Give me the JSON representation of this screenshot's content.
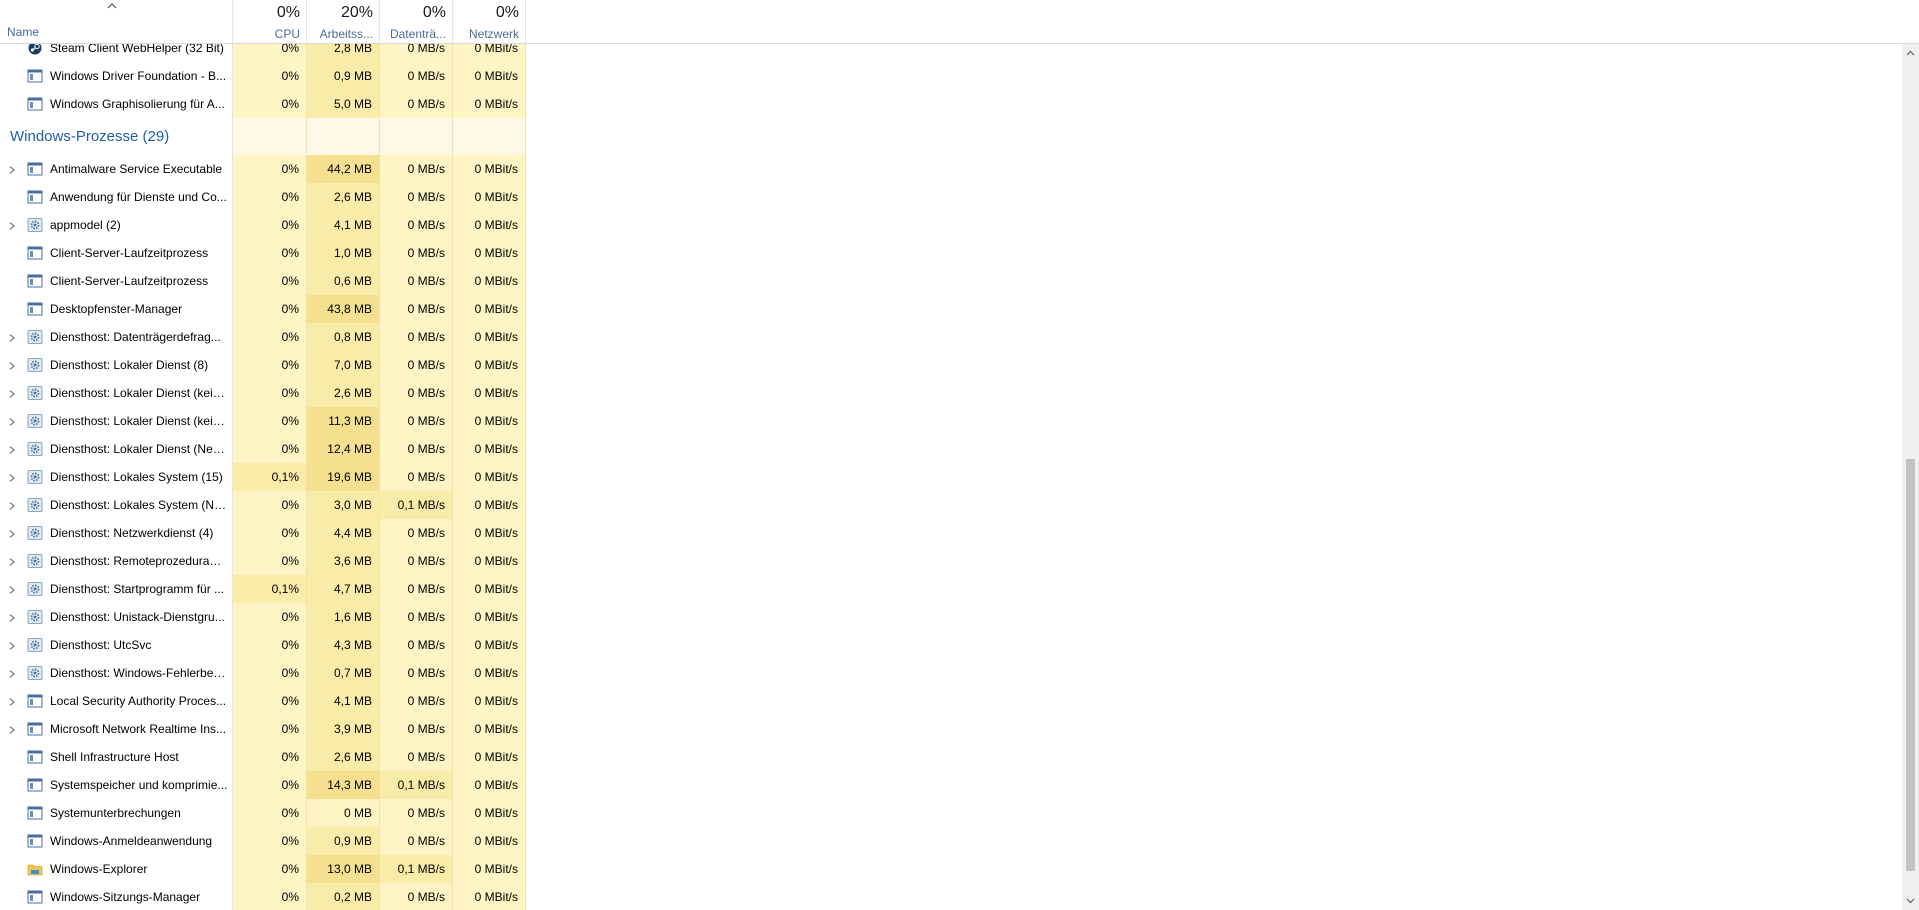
{
  "columns": {
    "name": {
      "label": "Name"
    },
    "cpu": {
      "percent": "0%",
      "label": "CPU"
    },
    "memory": {
      "percent": "20%",
      "label": "Arbeitss..."
    },
    "disk": {
      "percent": "0%",
      "label": "Datenträ..."
    },
    "network": {
      "percent": "0%",
      "label": "Netzwerk"
    }
  },
  "colors": {
    "heat_low": "#fff4c4",
    "heat_mid": "#f9eca9",
    "heat_high": "#f4e08f",
    "group_title": "#1e5fa8"
  },
  "top_rows": [
    {
      "name": "Steam Client WebHelper (32 Bit)",
      "cpu": "0%",
      "mem": "2,8 MB",
      "disk": "0 MB/s",
      "net": "0 MBit/s",
      "icon": "steam-icon",
      "expand": false
    },
    {
      "name": "Windows Driver Foundation - B...",
      "cpu": "0%",
      "mem": "0,9 MB",
      "disk": "0 MB/s",
      "net": "0 MBit/s",
      "icon": "window-icon",
      "expand": false
    },
    {
      "name": "Windows Graphisolierung für A...",
      "cpu": "0%",
      "mem": "5,0 MB",
      "disk": "0 MB/s",
      "net": "0 MBit/s",
      "icon": "window-icon",
      "expand": false
    }
  ],
  "group": {
    "title": "Windows-Prozesse (29)"
  },
  "rows": [
    {
      "name": "Antimalware Service Executable",
      "cpu": "0%",
      "mem": "44,2 MB",
      "disk": "0 MB/s",
      "net": "0 MBit/s",
      "icon": "window-icon",
      "expand": true
    },
    {
      "name": "Anwendung für Dienste und Co...",
      "cpu": "0%",
      "mem": "2,6 MB",
      "disk": "0 MB/s",
      "net": "0 MBit/s",
      "icon": "window-icon",
      "expand": false
    },
    {
      "name": "appmodel (2)",
      "cpu": "0%",
      "mem": "4,1 MB",
      "disk": "0 MB/s",
      "net": "0 MBit/s",
      "icon": "gear-icon",
      "expand": true
    },
    {
      "name": "Client-Server-Laufzeitprozess",
      "cpu": "0%",
      "mem": "1,0 MB",
      "disk": "0 MB/s",
      "net": "0 MBit/s",
      "icon": "window-icon",
      "expand": false
    },
    {
      "name": "Client-Server-Laufzeitprozess",
      "cpu": "0%",
      "mem": "0,6 MB",
      "disk": "0 MB/s",
      "net": "0 MBit/s",
      "icon": "window-icon",
      "expand": false
    },
    {
      "name": "Desktopfenster-Manager",
      "cpu": "0%",
      "mem": "43,8 MB",
      "disk": "0 MB/s",
      "net": "0 MBit/s",
      "icon": "window-icon",
      "expand": false
    },
    {
      "name": "Diensthost: Datenträgerdefrag...",
      "cpu": "0%",
      "mem": "0,8 MB",
      "disk": "0 MB/s",
      "net": "0 MBit/s",
      "icon": "gear-icon",
      "expand": true
    },
    {
      "name": "Diensthost: Lokaler Dienst (8)",
      "cpu": "0%",
      "mem": "7,0 MB",
      "disk": "0 MB/s",
      "net": "0 MBit/s",
      "icon": "gear-icon",
      "expand": true
    },
    {
      "name": "Diensthost: Lokaler Dienst (kein ...",
      "cpu": "0%",
      "mem": "2,6 MB",
      "disk": "0 MB/s",
      "net": "0 MBit/s",
      "icon": "gear-icon",
      "expand": true
    },
    {
      "name": "Diensthost: Lokaler Dienst (kein ...",
      "cpu": "0%",
      "mem": "11,3 MB",
      "disk": "0 MB/s",
      "net": "0 MBit/s",
      "icon": "gear-icon",
      "expand": true
    },
    {
      "name": "Diensthost: Lokaler Dienst (Netz...",
      "cpu": "0%",
      "mem": "12,4 MB",
      "disk": "0 MB/s",
      "net": "0 MBit/s",
      "icon": "gear-icon",
      "expand": true
    },
    {
      "name": "Diensthost: Lokales System (15)",
      "cpu": "0,1%",
      "mem": "19,6 MB",
      "disk": "0 MB/s",
      "net": "0 MBit/s",
      "icon": "gear-icon",
      "expand": true
    },
    {
      "name": "Diensthost: Lokales System (Net...",
      "cpu": "0%",
      "mem": "3,0 MB",
      "disk": "0,1 MB/s",
      "net": "0 MBit/s",
      "icon": "gear-icon",
      "expand": true
    },
    {
      "name": "Diensthost: Netzwerkdienst (4)",
      "cpu": "0%",
      "mem": "4,4 MB",
      "disk": "0 MB/s",
      "net": "0 MBit/s",
      "icon": "gear-icon",
      "expand": true
    },
    {
      "name": "Diensthost: Remoteprozedurauf...",
      "cpu": "0%",
      "mem": "3,6 MB",
      "disk": "0 MB/s",
      "net": "0 MBit/s",
      "icon": "gear-icon",
      "expand": true
    },
    {
      "name": "Diensthost: Startprogramm für ...",
      "cpu": "0,1%",
      "mem": "4,7 MB",
      "disk": "0 MB/s",
      "net": "0 MBit/s",
      "icon": "gear-icon",
      "expand": true
    },
    {
      "name": "Diensthost: Unistack-Dienstgru...",
      "cpu": "0%",
      "mem": "1,6 MB",
      "disk": "0 MB/s",
      "net": "0 MBit/s",
      "icon": "gear-icon",
      "expand": true
    },
    {
      "name": "Diensthost: UtcSvc",
      "cpu": "0%",
      "mem": "4,3 MB",
      "disk": "0 MB/s",
      "net": "0 MBit/s",
      "icon": "gear-icon",
      "expand": true
    },
    {
      "name": "Diensthost: Windows-Fehlerberi...",
      "cpu": "0%",
      "mem": "0,7 MB",
      "disk": "0 MB/s",
      "net": "0 MBit/s",
      "icon": "gear-icon",
      "expand": true
    },
    {
      "name": "Local Security Authority Proces...",
      "cpu": "0%",
      "mem": "4,1 MB",
      "disk": "0 MB/s",
      "net": "0 MBit/s",
      "icon": "window-icon",
      "expand": true
    },
    {
      "name": "Microsoft Network Realtime Ins...",
      "cpu": "0%",
      "mem": "3,9 MB",
      "disk": "0 MB/s",
      "net": "0 MBit/s",
      "icon": "window-icon",
      "expand": true
    },
    {
      "name": "Shell Infrastructure Host",
      "cpu": "0%",
      "mem": "2,6 MB",
      "disk": "0 MB/s",
      "net": "0 MBit/s",
      "icon": "window-icon",
      "expand": false
    },
    {
      "name": "Systemspeicher und komprimie...",
      "cpu": "0%",
      "mem": "14,3 MB",
      "disk": "0,1 MB/s",
      "net": "0 MBit/s",
      "icon": "window-icon",
      "expand": false
    },
    {
      "name": "Systemunterbrechungen",
      "cpu": "0%",
      "mem": "0 MB",
      "disk": "0 MB/s",
      "net": "0 MBit/s",
      "icon": "window-icon",
      "expand": false
    },
    {
      "name": "Windows-Anmeldeanwendung",
      "cpu": "0%",
      "mem": "0,9 MB",
      "disk": "0 MB/s",
      "net": "0 MBit/s",
      "icon": "window-icon",
      "expand": false
    },
    {
      "name": "Windows-Explorer",
      "cpu": "0%",
      "mem": "13,0 MB",
      "disk": "0,1 MB/s",
      "net": "0 MBit/s",
      "icon": "folder-icon",
      "expand": false
    },
    {
      "name": "Windows-Sitzungs-Manager",
      "cpu": "0%",
      "mem": "0,2 MB",
      "disk": "0 MB/s",
      "net": "0 MBit/s",
      "icon": "window-icon",
      "expand": false
    }
  ]
}
